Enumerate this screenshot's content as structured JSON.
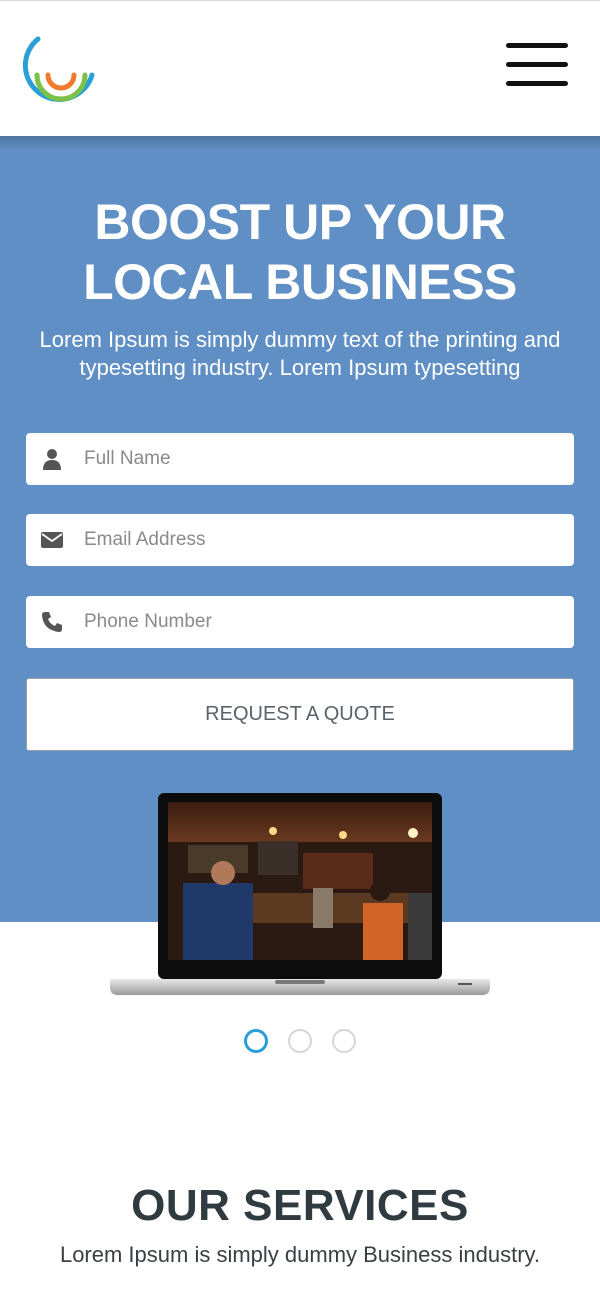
{
  "header": {
    "logo_icon": "rainbow-arc-logo",
    "menu_icon": "hamburger-icon"
  },
  "hero": {
    "title_line1": "BOOST UP YOUR",
    "title_line2": "LOCAL BUSINESS",
    "text": "Lorem Ipsum is simply dummy text of the printing and typesetting industry. Lorem Ipsum typesetting",
    "background": "#5f8fc5"
  },
  "form": {
    "full_name": {
      "placeholder": "Full Name",
      "value": "",
      "icon": "user-icon"
    },
    "email": {
      "placeholder": "Email Address",
      "value": "",
      "icon": "envelope-icon"
    },
    "phone": {
      "placeholder": "Phone Number",
      "value": "",
      "icon": "phone-icon"
    },
    "submit_label": "REQUEST A QUOTE"
  },
  "slider": {
    "image_icon": "laptop-with-cafe-photo",
    "slide_count": 3,
    "active_slide": 1,
    "accent": "#2a9fd6"
  },
  "services": {
    "title": "OUR SERVICES",
    "text": "Lorem Ipsum is simply dummy Business industry."
  }
}
